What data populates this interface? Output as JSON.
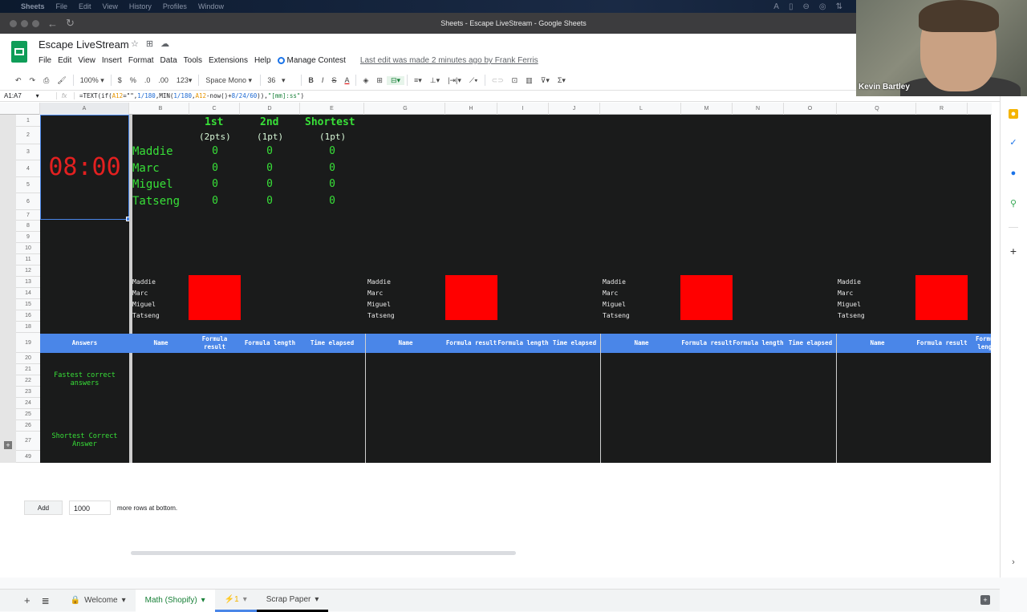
{
  "macos_menu": {
    "app": "Sheets",
    "items": [
      "File",
      "Edit",
      "View",
      "History",
      "Profiles",
      "Window"
    ]
  },
  "window_title": "Sheets - Escape LiveStream - Google Sheets",
  "doc": {
    "title": "Escape LiveStream",
    "menu": [
      "File",
      "Edit",
      "View",
      "Insert",
      "Format",
      "Data",
      "Tools",
      "Extensions",
      "Help"
    ],
    "manage_contest": "Manage Contest",
    "last_edit": "Last edit was made 2 minutes ago by Frank Ferris"
  },
  "toolbar": {
    "zoom": "100%",
    "currency": "$",
    "percent": "%",
    "dec_less": ".0",
    "dec_more": ".00",
    "format_more": "123",
    "font": "Space Mono",
    "font_size": "36",
    "bold": "B",
    "italic": "I",
    "strike": "S",
    "text_color": "A"
  },
  "formula_bar": {
    "range": "A1:A7",
    "fx": "fx",
    "formula_parts": [
      "=TEXT(if(",
      "A12",
      "=\"\",",
      "1/180",
      ",MIN(",
      "1/180",
      ",",
      "A12",
      "-now()+",
      "8/24/60",
      ")),",
      "\"[mm]:ss\"",
      ")"
    ]
  },
  "columns": [
    "A",
    "B",
    "C",
    "D",
    "E",
    "G",
    "H",
    "I",
    "J",
    "L",
    "M",
    "N",
    "O",
    "Q",
    "R"
  ],
  "rows": [
    "1",
    "2",
    "3",
    "4",
    "5",
    "6",
    "7",
    "8",
    "9",
    "10",
    "11",
    "12",
    "13",
    "14",
    "15",
    "16",
    "18",
    "19",
    "20",
    "21",
    "22",
    "23",
    "24",
    "25",
    "26",
    "27",
    "49"
  ],
  "timer": "08:00",
  "scoreboard": {
    "headers": [
      "1st",
      "2nd",
      "Shortest"
    ],
    "subheaders": [
      "(2pts)",
      "(1pt)",
      "(1pt)"
    ],
    "players": [
      {
        "name": "Maddie",
        "scores": [
          "0",
          "0",
          "0"
        ]
      },
      {
        "name": "Marc",
        "scores": [
          "0",
          "0",
          "0"
        ]
      },
      {
        "name": "Miguel",
        "scores": [
          "0",
          "0",
          "0"
        ]
      },
      {
        "name": "Tatseng",
        "scores": [
          "0",
          "0",
          "0"
        ]
      }
    ]
  },
  "contestant_panels": [
    {
      "names": [
        "Maddie",
        "Marc",
        "Miguel",
        "Tatseng"
      ],
      "indicator_color": "#ff0000"
    },
    {
      "names": [
        "Maddie",
        "Marc",
        "Miguel",
        "Tatseng"
      ],
      "indicator_color": "#ff0000"
    },
    {
      "names": [
        "Maddie",
        "Marc",
        "Miguel",
        "Tatseng"
      ],
      "indicator_color": "#ff0000"
    },
    {
      "names": [
        "Maddie",
        "Marc",
        "Miguel",
        "Tatseng"
      ],
      "indicator_color": "#ff0000"
    }
  ],
  "answer_headers": {
    "answers": "Answers",
    "groups": [
      [
        "Name",
        "Formula result",
        "Formula length",
        "Time elapsed"
      ],
      [
        "Name",
        "Formula result",
        "Formula length",
        "Time elapsed"
      ],
      [
        "Name",
        "Formula result",
        "Formula length",
        "Time elapsed"
      ],
      [
        "Name",
        "Formula result",
        "Formula length"
      ]
    ]
  },
  "answer_labels": {
    "fastest": "Fastest correct answers",
    "shortest": "Shortest Correct Answer"
  },
  "add_rows": {
    "button": "Add",
    "count": "1000",
    "suffix": "more rows at bottom."
  },
  "tabs": [
    {
      "label": "Welcome",
      "locked": true
    },
    {
      "label": "Math (Shopify)",
      "active": true
    },
    {
      "label": "⚡1"
    },
    {
      "label": "Scrap Paper"
    }
  ],
  "video": {
    "participant": "Kevin Bartley"
  },
  "colors": {
    "sheet_bg": "#1a1b1b",
    "green_text": "#38e038",
    "timer_red": "#e32020",
    "header_blue": "#4a86e8",
    "indicator_red": "#ff0000"
  }
}
